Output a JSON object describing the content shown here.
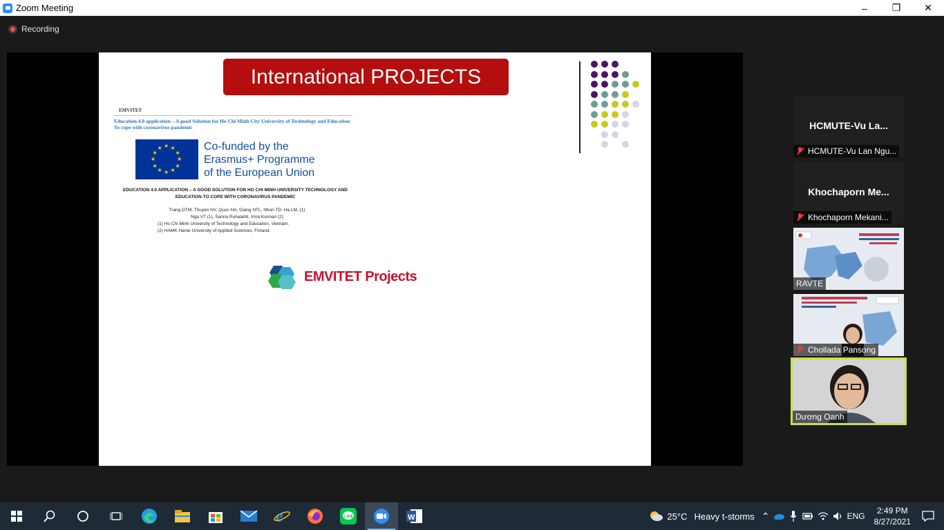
{
  "window": {
    "title": "Zoom Meeting",
    "controls": {
      "minimize": "–",
      "restore": "❐",
      "close": "✕"
    }
  },
  "recording": {
    "label": "Recording"
  },
  "slide": {
    "title": "International PROJECTS",
    "paper_header": "EMVITET",
    "paper_title": "Education 4.0 application – A good Solution for Ho Chi Minh City University of Technology and Education To cope with coronavirus pandemic",
    "eu_text": [
      "Co-funded by the",
      "Erasmus+ Programme",
      "of the European Union"
    ],
    "caps_title": "EDUCATION 4.0 APPLICATION – A GOOD SOLUTION FOR HO CHI MINH UNIVERSITY TECHNOLOGY AND EDUCATION TO COPE WITH CORONAVIRUS PANDEMIC",
    "authors": [
      "Trang DTM, Thuyen NV, Quoc HA, Giang NTL, Nhon TD, Ha LM, (1)",
      "Nga VT (1), Sanna Ruhalahti, Irma Kunnari (2)",
      "(1)    Ho Chi Minh University of Technology and Education, Vietnam.",
      "(2)    HAMK Hame University of Applied Sciences, Finland."
    ],
    "emvitet_logo": "EMVITET Projects",
    "accent_colors": {
      "title_bg": "#b40e0e",
      "purple": "#4a1566",
      "teal": "#6f9a9a",
      "yellow": "#c8c820",
      "lavender": "#d8d4e8"
    }
  },
  "participants": [
    {
      "display": "HCMUTE-Vu  La...",
      "label": "HCMUTE-Vu Lan Ngu...",
      "muted": true,
      "video": false
    },
    {
      "display": "Khochaporn  Me...",
      "label": "Khochaporn Mekani...",
      "muted": true,
      "video": false
    },
    {
      "label": "RAVTE",
      "muted": false,
      "video": true
    },
    {
      "label": "Chollada Pansong",
      "muted": true,
      "video": true
    },
    {
      "label": "Dương Oanh",
      "muted": false,
      "video": true,
      "active_speaker": true
    }
  ],
  "taskbar": {
    "weather_temp": "25°C",
    "weather_text": "Heavy t-storms",
    "language": "ENG",
    "time": "2:49 PM",
    "date": "8/27/2021",
    "apps": [
      "start-icon",
      "search-icon",
      "cortana-icon",
      "task-view-icon",
      "edge-icon",
      "file-explorer-icon",
      "store-icon",
      "mail-icon",
      "ie-icon",
      "firefox-icon",
      "line-icon",
      "zoom-icon",
      "word-icon"
    ]
  }
}
